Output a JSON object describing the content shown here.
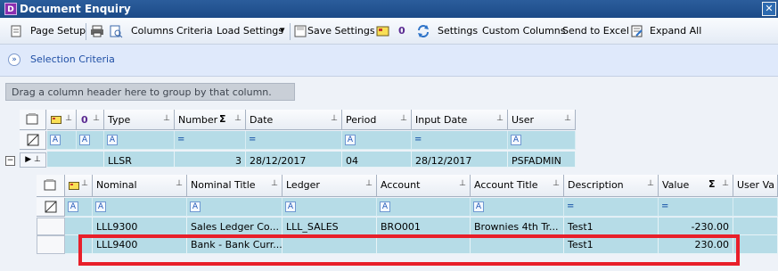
{
  "window": {
    "title": "Document Enquiry",
    "app_icon_letter": "D",
    "close_glyph": "✕"
  },
  "toolbar": {
    "page_setup": "Page Setup",
    "columns": "Columns",
    "criteria": "Criteria",
    "load_settings": "Load Settings",
    "save_settings": "Save Settings",
    "settings": "Settings",
    "custom_columns": "Custom Columns",
    "send_to_excel": "Send to Excel",
    "expand_all": "Expand All",
    "zero_label": "0",
    "dropdown_glyph": "▾"
  },
  "selection": {
    "label": "Selection Criteria"
  },
  "group_area": {
    "placeholder": "Drag a column header here to group by that column."
  },
  "parent_grid": {
    "columns": [
      "Type",
      "Number",
      "Date",
      "Period",
      "Input Date",
      "User"
    ],
    "icons": {
      "document_icon": "document-icon",
      "note_icon": "note-icon",
      "pin_icon": "pin-icon",
      "zero_icon": "0",
      "sum_icon": "Σ"
    },
    "filter_symbols": [
      "A",
      "A",
      "A",
      "=",
      "=",
      "A",
      "=",
      "A"
    ],
    "row": {
      "type": "LLSR",
      "number": "3",
      "date": "28/12/2017",
      "period": "04",
      "input_date": "28/12/2017",
      "user": "PSFADMIN"
    }
  },
  "child_grid": {
    "columns": [
      "Nominal",
      "Nominal Title",
      "Ledger",
      "Account",
      "Account Title",
      "Description",
      "Value",
      "User Va"
    ],
    "filter_symbols": [
      "A",
      "A",
      "A",
      "A",
      "A",
      "A",
      "=",
      "="
    ],
    "rows": [
      {
        "nominal": "LLL9300",
        "nominal_title": "Sales Ledger Co...",
        "ledger": "LLL_SALES",
        "account": "BRO001",
        "account_title": "Brownies 4th Tr...",
        "description": "Test1",
        "value": "-230.00"
      },
      {
        "nominal": "LLL9400",
        "nominal_title": "Bank - Bank Curr...",
        "ledger": "",
        "account": "",
        "account_title": "",
        "description": "Test1",
        "value": "230.00"
      }
    ]
  },
  "colors": {
    "title_bar": "#1c4a87",
    "row_fill": "#b6dce7",
    "highlight": "#e81f2a",
    "selection_text": "#1f4fa5"
  }
}
